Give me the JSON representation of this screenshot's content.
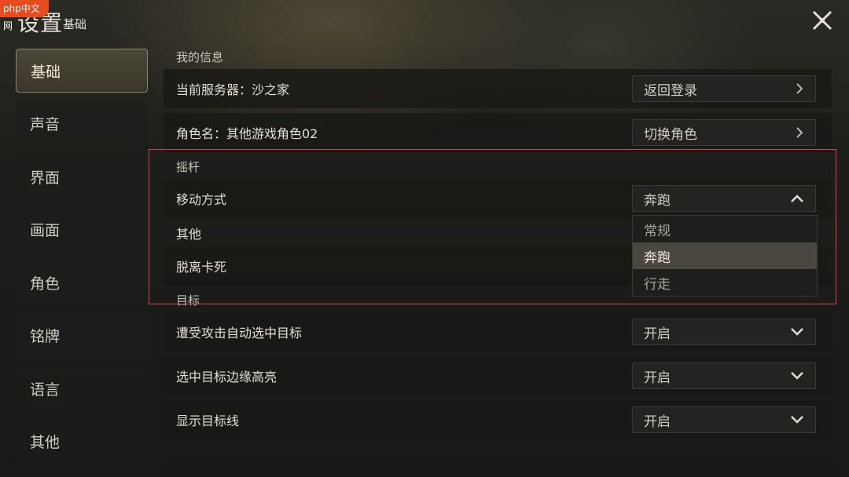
{
  "watermark": "php中文网",
  "header": {
    "title": "设置",
    "subtitle": "基础"
  },
  "sidebar": {
    "items": [
      {
        "label": "基础",
        "active": true
      },
      {
        "label": "声音"
      },
      {
        "label": "界面"
      },
      {
        "label": "画面"
      },
      {
        "label": "角色"
      },
      {
        "label": "铭牌"
      },
      {
        "label": "语言"
      },
      {
        "label": "其他"
      }
    ]
  },
  "sections": {
    "my_info": "我的信息",
    "joystick": "摇杆",
    "target": "目标"
  },
  "rows": {
    "server": {
      "label": "当前服务器：沙之家",
      "button": "返回登录"
    },
    "character": {
      "label": "角色名：其他游戏角色02",
      "button": "切换角色"
    },
    "move_mode": {
      "label": "移动方式",
      "value": "奔跑",
      "options": [
        "常规",
        "奔跑",
        "行走"
      ]
    },
    "other": {
      "label": "其他"
    },
    "unstuck": {
      "label": "脱离卡死"
    },
    "auto_target": {
      "label": "遭受攻击自动选中目标",
      "value": "开启"
    },
    "edge_highlight": {
      "label": "选中目标边缘高亮",
      "value": "开启"
    },
    "target_line": {
      "label": "显示目标线",
      "value": "开启"
    }
  },
  "colors": {
    "highlight_border": "#d8423f",
    "active_tab": "#4b4738",
    "watermark_bg": "#e84c1c"
  }
}
